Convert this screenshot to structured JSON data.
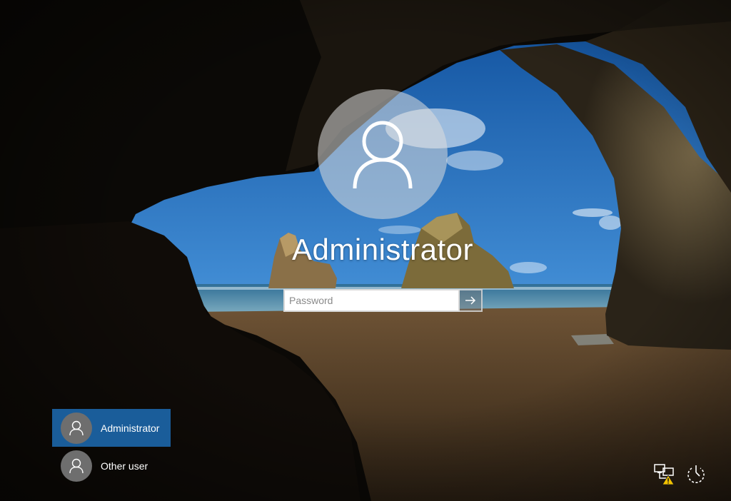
{
  "lock_screen": {
    "selected_user": "Administrator",
    "password_placeholder": "Password",
    "password_value": "",
    "submit_icon": "arrow-right-icon",
    "user_icon": "user-icon"
  },
  "user_list": [
    {
      "label": "Administrator",
      "selected": true
    },
    {
      "label": "Other user",
      "selected": false
    }
  ],
  "corner_controls": {
    "network_icon": "network-warning-icon",
    "power_icon": "power-icon"
  },
  "colors": {
    "selection": "#1a5d9a",
    "text": "#ffffff",
    "warning": "#f2c200"
  }
}
